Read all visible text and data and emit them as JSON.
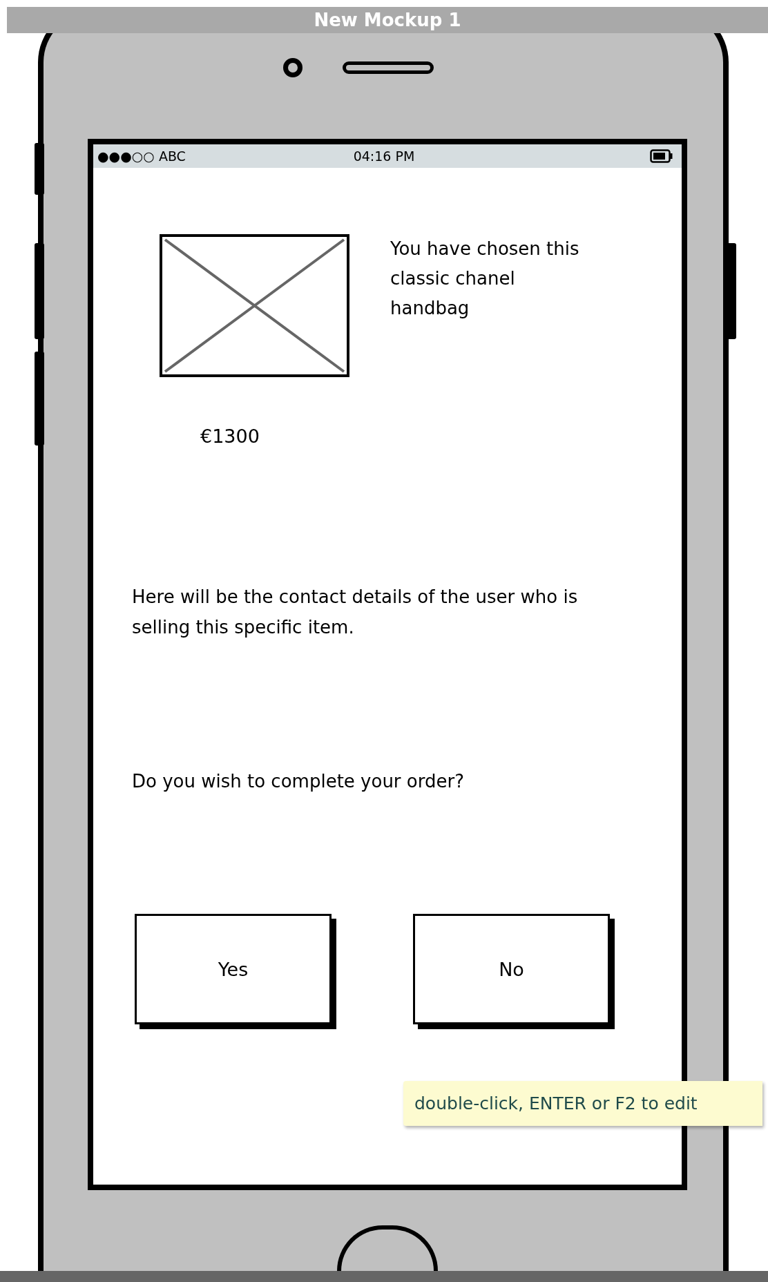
{
  "window": {
    "title": "New Mockup 1"
  },
  "status_bar": {
    "signal": "●●●○○",
    "carrier": "ABC",
    "time": "04:16 PM"
  },
  "product": {
    "description": "You have chosen this classic chanel handbag",
    "price": "€1300"
  },
  "contact_text": "Here will be the contact details of the user who is selling this specific item.",
  "question": "Do you wish to complete your order?",
  "buttons": [
    {
      "label": "Yes"
    },
    {
      "label": "No"
    }
  ],
  "tooltip": "double-click, ENTER or F2 to edit"
}
